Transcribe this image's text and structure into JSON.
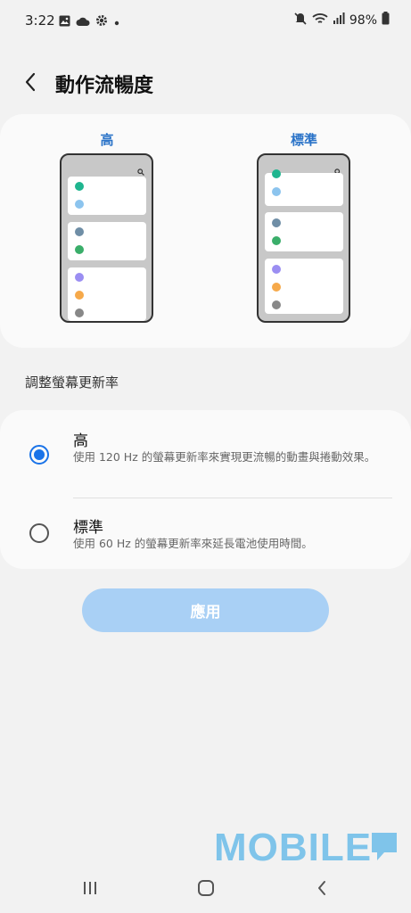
{
  "status_bar": {
    "time": "3:22",
    "battery": "98%",
    "left_icons": [
      "image-icon",
      "cloud-icon",
      "gear-icon",
      "dot-icon"
    ],
    "right_icons": [
      "mute-icon",
      "wifi-icon",
      "signal-icon",
      "battery-icon"
    ]
  },
  "header": {
    "title": "動作流暢度",
    "back_icon": "chevron-left-icon"
  },
  "preview": {
    "high_label": "高",
    "standard_label": "標準"
  },
  "section_label": "調整螢幕更新率",
  "options": [
    {
      "title": "高",
      "description": "使用 120 Hz 的螢幕更新率來實現更流暢的動畫與捲動效果。",
      "selected": true
    },
    {
      "title": "標準",
      "description": "使用 60 Hz 的螢幕更新率來延長電池使用時間。",
      "selected": false
    }
  ],
  "apply_button": "應用",
  "watermark": "MOBILE",
  "colors": {
    "accent": "#1a73e8",
    "label_blue": "#2a73c8",
    "apply_disabled": "#a9d0f5",
    "watermark": "#7fc4ea"
  },
  "nav_icons": [
    "recents-icon",
    "home-icon",
    "back-icon"
  ]
}
